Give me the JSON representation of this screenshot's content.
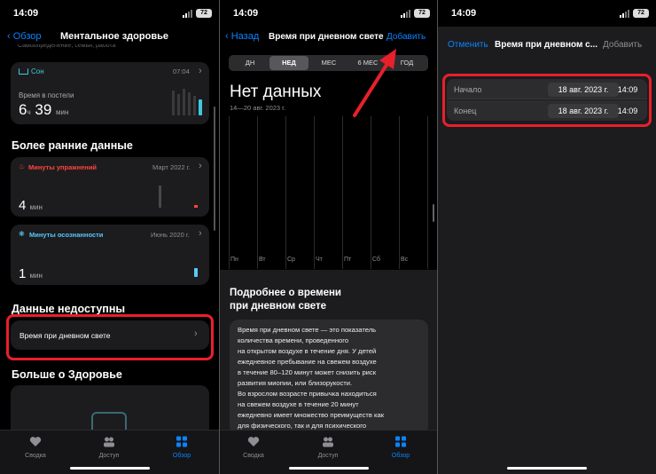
{
  "status": {
    "time": "14:09",
    "battery": "72"
  },
  "screen1": {
    "back_label": "Обзор",
    "title": "Ментальное здоровье",
    "top_cut_text": "Самоопределение, семьи, работа",
    "sleep": {
      "label": "Сон",
      "time": "07:04",
      "caption": "Время в постели",
      "hours": "6",
      "hours_unit": "ч",
      "minutes": "39",
      "minutes_unit": "мин"
    },
    "earlier_header": "Более ранние данные",
    "exercise": {
      "label": "Минуты упражнений",
      "date": "Март 2022 г.",
      "value": "4",
      "unit": "мин"
    },
    "mindful": {
      "label": "Минуты осознанности",
      "date": "Июнь 2020 г.",
      "value": "1",
      "unit": "мин"
    },
    "unavailable_header": "Данные недоступны",
    "daylight_item": "Время при дневном свете",
    "more_header": "Больше о Здоровье"
  },
  "screen2": {
    "back_label": "Назад",
    "title": "Время при дневном свете",
    "add_label": "Добавить",
    "segments": [
      "ДН",
      "НЕД",
      "МЕС",
      "6 МЕС",
      "ГОД"
    ],
    "selected_segment": "НЕД",
    "no_data": "Нет данных",
    "range": "14—20 авг. 2023 г.",
    "days": [
      "Пн",
      "Вт",
      "Ср",
      "Чт",
      "Пт",
      "Сб",
      "Вс"
    ],
    "about_title_1": "Подробнее о времени",
    "about_title_2": "при дневном свете",
    "about_lines": [
      "Время при дневном свете — это показатель",
      "количества времени, проведенного",
      "на открытом воздухе в течение дня. У детей",
      "ежедневное пребывание на свежем воздухе",
      "в течение 80–120 минут может снизить риск",
      "развития миопии, или близорукости.",
      "Во взрослом возрасте привычка находиться",
      "на свежем воздухе в течение 20 минут",
      "ежедневно имеет множество преимуществ как",
      "для физического, так и для психического"
    ]
  },
  "screen3": {
    "cancel_label": "Отменить",
    "title": "Время при дневном с...",
    "add_label": "Добавить",
    "start_label": "Начало",
    "start_date": "18 авг. 2023 г.",
    "start_time": "14:09",
    "end_label": "Конец",
    "end_date": "18 авг. 2023 г.",
    "end_time": "14:09"
  },
  "tabs": [
    {
      "label": "Сводка",
      "icon": "heart-icon",
      "active": false
    },
    {
      "label": "Доступ",
      "icon": "people-icon",
      "active": false
    },
    {
      "label": "Обзор",
      "icon": "grid-icon",
      "active": true
    }
  ],
  "colors": {
    "accent": "#0a84ff",
    "exercise": "#ff453a",
    "mindful": "#5ac8fa",
    "sleep": "#40c8e0",
    "highlight": "#e8202b"
  }
}
